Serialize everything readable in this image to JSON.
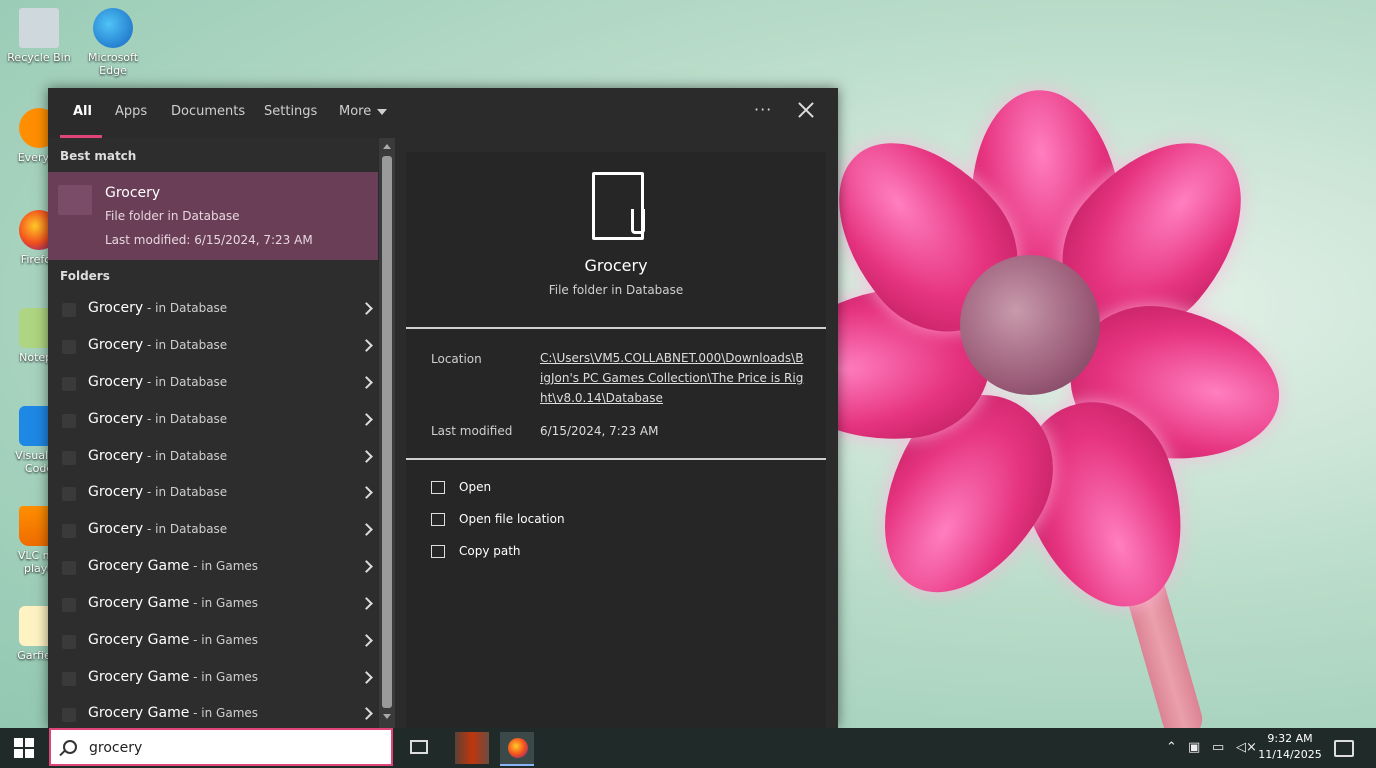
{
  "desktop": {
    "icons": [
      {
        "label": "Recycle Bin"
      },
      {
        "label": "Microsoft Edge"
      },
      {
        "label": "Everyth"
      },
      {
        "label": "Firefox"
      },
      {
        "label": "Notepa"
      },
      {
        "label": "Visual St Code"
      },
      {
        "label": "VLC me playe"
      },
      {
        "label": "Garfield"
      }
    ]
  },
  "search_panel": {
    "tabs": [
      {
        "label": "All"
      },
      {
        "label": "Apps"
      },
      {
        "label": "Documents"
      },
      {
        "label": "Settings"
      },
      {
        "label": "More"
      }
    ],
    "best_match_heading": "Best match",
    "best_match": {
      "title": "Grocery",
      "subtitle": "File folder in Database",
      "modified": "Last modified: 6/15/2024, 7:23 AM"
    },
    "folders_heading": "Folders",
    "results": [
      {
        "name": "Grocery",
        "loc": " - in Database"
      },
      {
        "name": "Grocery",
        "loc": " - in Database"
      },
      {
        "name": "Grocery",
        "loc": " - in Database"
      },
      {
        "name": "Grocery",
        "loc": " - in Database"
      },
      {
        "name": "Grocery",
        "loc": " - in Database"
      },
      {
        "name": "Grocery",
        "loc": " - in Database"
      },
      {
        "name": "Grocery",
        "loc": " - in Database"
      },
      {
        "name": "Grocery Game",
        "loc": " - in Games"
      },
      {
        "name": "Grocery Game",
        "loc": " - in Games"
      },
      {
        "name": "Grocery Game",
        "loc": " - in Games"
      },
      {
        "name": "Grocery Game",
        "loc": " - in Games"
      },
      {
        "name": "Grocery Game",
        "loc": " - in Games"
      }
    ],
    "preview": {
      "title": "Grocery",
      "subtitle": "File folder in Database",
      "location_label": "Location",
      "location_value": "C:\\Users\\VM5.COLLABNET.000\\Downloads\\BigJon's PC Games Collection\\The Price is Right\\v8.0.14\\Database",
      "modified_label": "Last modified",
      "modified_value": "6/15/2024, 7:23 AM",
      "actions": [
        {
          "label": "Open"
        },
        {
          "label": "Open file location"
        },
        {
          "label": "Copy path"
        }
      ]
    }
  },
  "taskbar": {
    "search_query": "grocery",
    "clock_time": "9:32 AM",
    "clock_date": "11/14/2025"
  },
  "colors": {
    "accent": "#e0457a",
    "selected_row": "#6b3e58",
    "panel_bg": "#2b2b2b"
  }
}
